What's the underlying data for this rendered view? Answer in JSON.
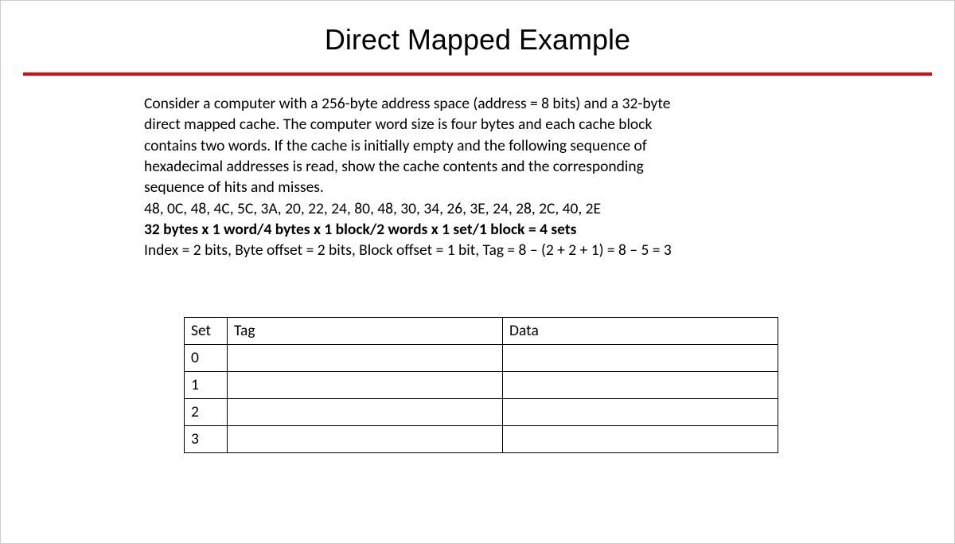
{
  "title": "Direct Mapped Example",
  "paragraph": {
    "p1": "Consider a computer with a 256-byte address space (address = 8 bits) and a 32-byte",
    "p2": "direct mapped cache. The computer word size is four bytes and each cache block",
    "p3": "contains two words. If the cache is initially empty and the following sequence of",
    "p4": "hexadecimal addresses is read, show the cache contents and the corresponding",
    "p5": "sequence of hits and misses.",
    "p6": "48, 0C, 48, 4C, 5C, 3A, 20, 22, 24, 80, 48, 30, 34, 26, 3E, 24, 28, 2C, 40, 2E",
    "p7": "32 bytes x 1 word/4 bytes x 1 block/2 words  x 1 set/1 block = 4 sets",
    "p8": "Index = 2 bits, Byte offset = 2 bits, Block offset = 1 bit, Tag = 8 – (2 + 2 + 1) = 8 –  5 = 3"
  },
  "table": {
    "headers": {
      "set": "Set",
      "tag": "Tag",
      "data": "Data"
    },
    "rows": [
      {
        "set": "0",
        "tag": "",
        "data": ""
      },
      {
        "set": "1",
        "tag": "",
        "data": ""
      },
      {
        "set": "2",
        "tag": "",
        "data": ""
      },
      {
        "set": "3",
        "tag": "",
        "data": ""
      }
    ]
  }
}
